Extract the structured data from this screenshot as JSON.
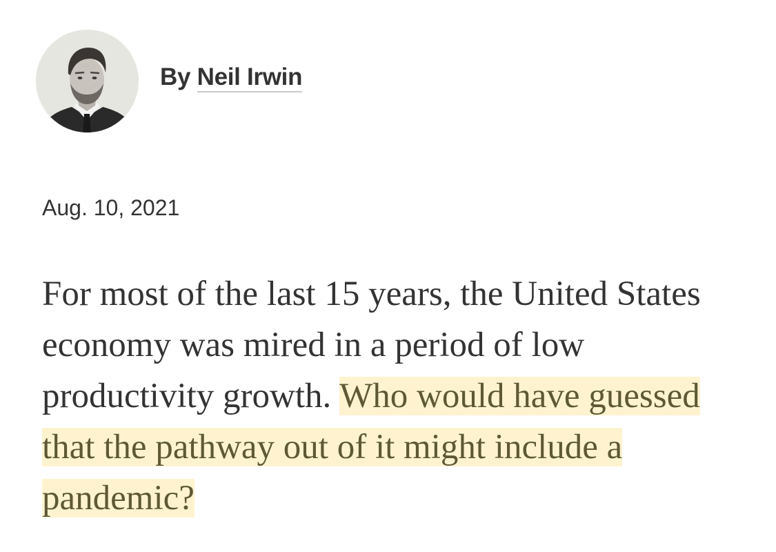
{
  "byline": {
    "prefix": "By",
    "author": "Neil Irwin"
  },
  "date": "Aug. 10, 2021",
  "paragraph": {
    "text_before_highlight": "For most of the last 15 years, the United States economy was mired in a period of low productivity growth. ",
    "highlighted_text": "Who would have guessed that the pathway out of it might include a pandemic?"
  },
  "colors": {
    "text": "#333333",
    "highlight_background": "#fff3cf",
    "highlight_text": "#5e5834",
    "author_underline": "#c9c9c9"
  },
  "icons": {
    "avatar": "author-portrait-photo"
  }
}
